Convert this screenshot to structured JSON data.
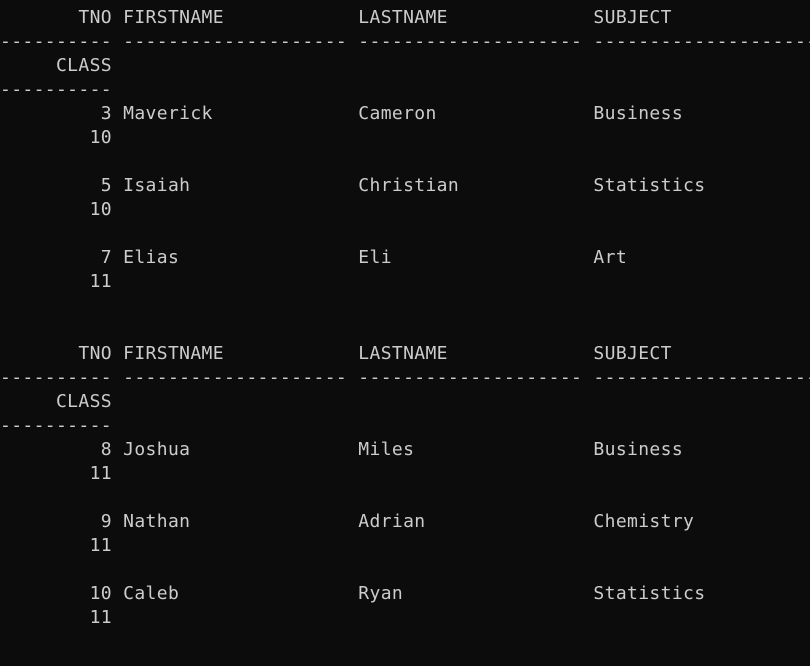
{
  "console": {
    "lines": [
      "       TNO FIRSTNAME            LASTNAME             SUBJECT",
      "---------- -------------------- -------------------- --------------------",
      "     CLASS",
      "----------",
      "         3 Maverick             Cameron              Business",
      "        10",
      "",
      "         5 Isaiah               Christian            Statistics",
      "        10",
      "",
      "         7 Elias                Eli                  Art",
      "        11",
      "",
      "",
      "       TNO FIRSTNAME            LASTNAME             SUBJECT",
      "---------- -------------------- -------------------- --------------------",
      "     CLASS",
      "----------",
      "         8 Joshua               Miles                Business",
      "        11",
      "",
      "         9 Nathan               Adrian               Chemistry",
      "        11",
      "",
      "        10 Caleb                Ryan                 Statistics",
      "        11",
      ""
    ]
  }
}
